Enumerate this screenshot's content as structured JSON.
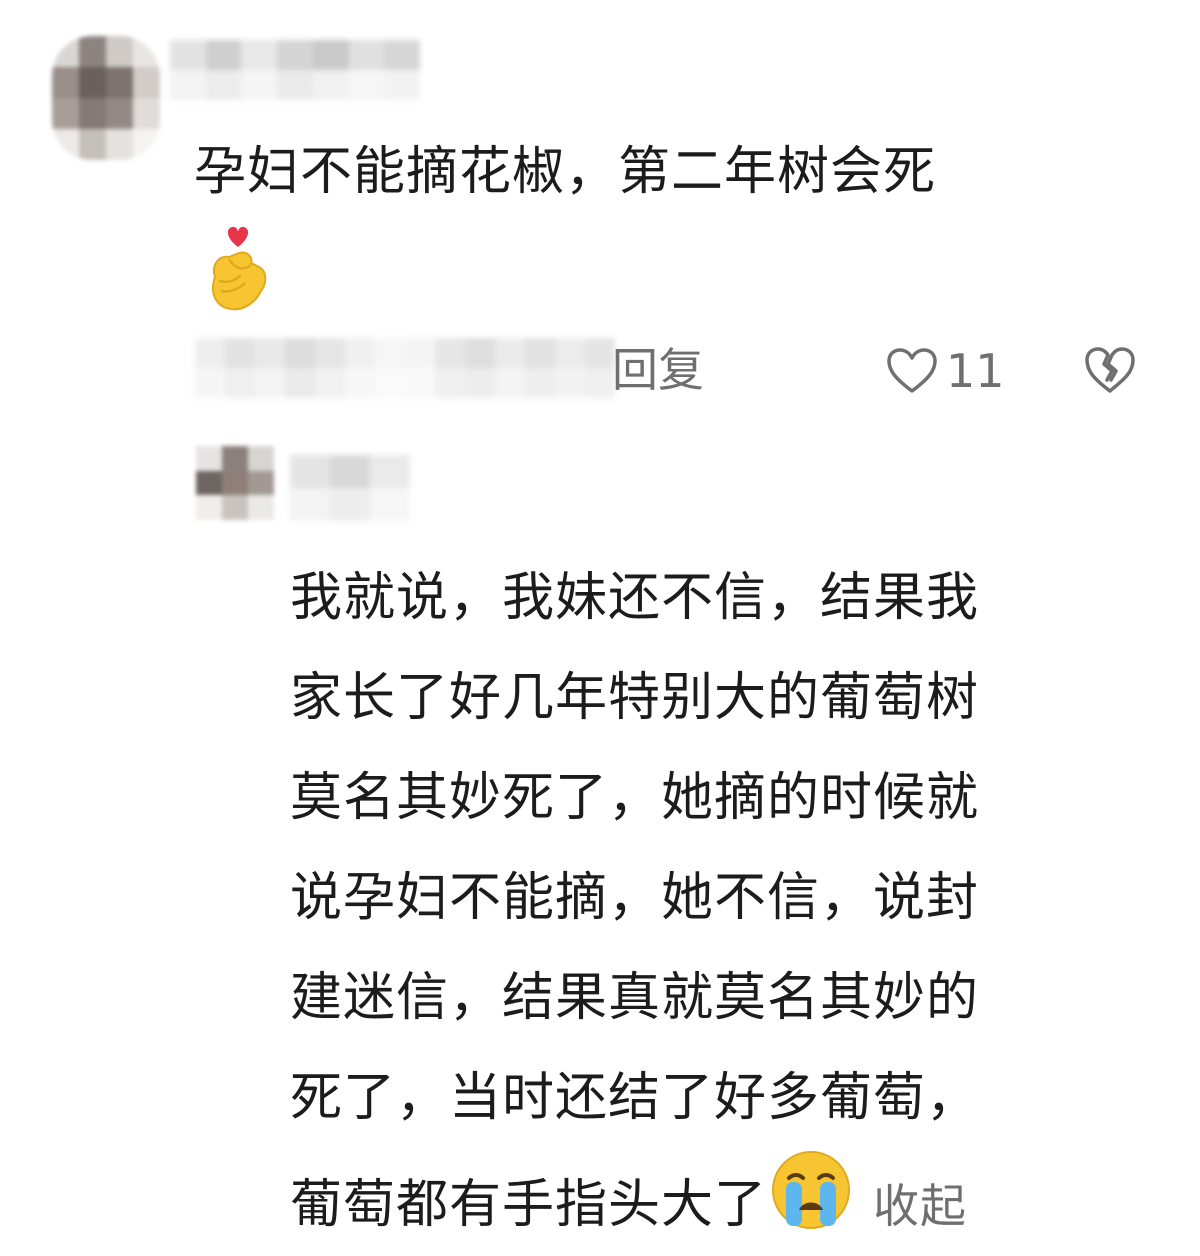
{
  "top_comment": {
    "text": "孕妇不能摘花椒，第二年树会死",
    "emoji": "finger-heart-icon",
    "reply_label": "回复",
    "like_count": "11",
    "like_icon": "heart-outline-icon",
    "dislike_icon": "broken-heart-icon"
  },
  "reply_comment": {
    "lines": [
      "我就说，我妹还不信，结果我",
      "家长了好几年特别大的葡萄树",
      "莫名其妙死了，她摘的时候就",
      "说孕妇不能摘，她不信，说封",
      "建迷信，结果真就莫名其妙的",
      "死了，当时还结了好多葡萄，",
      "葡萄都有手指头大了"
    ],
    "emoji": "crying-face-icon",
    "collapse_label": "收起"
  },
  "colors": {
    "text_primary": "#1c1c1c",
    "text_secondary": "#6f6f6f",
    "heart_red": "#e8344a",
    "emoji_yellow": "#f7c531"
  }
}
